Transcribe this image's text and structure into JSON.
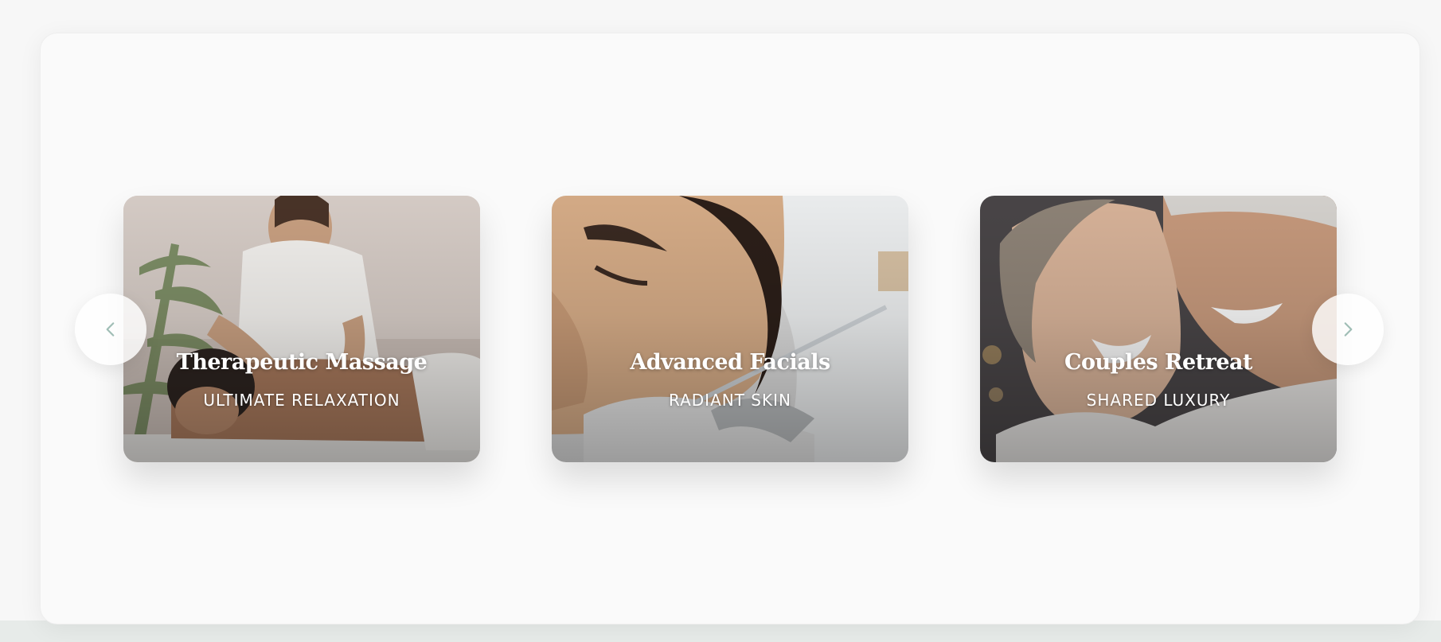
{
  "carousel": {
    "prev_icon": "chevron-left-icon",
    "next_icon": "chevron-right-icon",
    "accent_color": "#9fbdb5",
    "cards": [
      {
        "title": "Therapeutic Massage",
        "subtitle": "ULTIMATE RELAXATION"
      },
      {
        "title": "Advanced Facials",
        "subtitle": "RADIANT SKIN"
      },
      {
        "title": "Couples Retreat",
        "subtitle": "SHARED LUXURY"
      }
    ]
  }
}
